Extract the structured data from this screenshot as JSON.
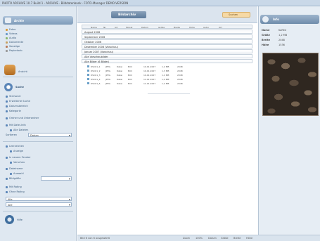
{
  "window": {
    "title": "PHOTO ARCHIVE 10.7 Build 1 - ARCHIVE · Bilddatenbank · FOTO-Manager DEMO-VERSION"
  },
  "sidebar": {
    "panel1_title": "Archiv",
    "items": [
      "Fotos",
      "Videos",
      "Audio",
      "Dokumente",
      "Sonstige",
      "Papierkorb"
    ],
    "panel2_title": "Ansicht",
    "search_section": {
      "title": "Suche",
      "items": [
        "Stichwort",
        "Erweiterte Suche",
        "Datumsbereich",
        "Kategorie",
        "Ordner und Unterordner",
        "Mit Datei-Info",
        "Alle Dateien"
      ],
      "sort_label": "Sortieren",
      "sort_value": "Datum",
      "options": [
        "Leerzeichen",
        "Anzeige",
        "In neuem Fenster",
        "Vorschau",
        "Dateiname",
        "Auswahl",
        "Bildgröße"
      ],
      "filter_items": [
        "Mit Rating",
        "Ohne Rating"
      ],
      "dropdown1": "Alle",
      "dropdown2": "Alle"
    },
    "panel3_title": "Hilfe"
  },
  "center": {
    "title": "Bildarchiv",
    "right_button": "Suchen",
    "columns": [
      "Name",
      "Nr.",
      "Art",
      "Monat",
      "Datum",
      "Größe",
      "Breite",
      "Höhe",
      "Autor",
      "Ort"
    ],
    "groups": [
      "August 2006",
      "September 2006",
      "Oktober 2006",
      "Dezember 2006 (Vorschau)",
      "Januar 2007 (Vorschau)",
      "Alle Vorschaubilder",
      "Alle Bilder (6 Bilder)"
    ],
    "files": [
      [
        "DSC01_1",
        "JPEG",
        "Datei",
        "Bild",
        "10.01.2007",
        "1,2 MB",
        "2048"
      ],
      [
        "DSC01_2",
        "JPEG",
        "Datei",
        "Bild",
        "10.01.2007",
        "1,3 MB",
        "2048"
      ],
      [
        "DSC01_3",
        "JPEG",
        "Datei",
        "Bild",
        "10.01.2007",
        "1,1 MB",
        "2048"
      ],
      [
        "DSC01_4",
        "JPEG",
        "Datei",
        "Bild",
        "11.01.2007",
        "1,4 MB",
        "2048"
      ],
      [
        "DSC01_5",
        "JPEG",
        "Datei",
        "Bild",
        "11.01.2007",
        "1,2 MB",
        "2048"
      ]
    ]
  },
  "right_panel": {
    "title": "Info",
    "props": [
      {
        "k": "Name",
        "v": "Kaffee"
      },
      {
        "k": "Größe",
        "v": "1,2 MB"
      },
      {
        "k": "Breite",
        "v": "2048"
      },
      {
        "k": "Höhe",
        "v": "1536"
      }
    ]
  },
  "status": {
    "left": "Bild 6 von 6 ausgewählt",
    "items": [
      "Zoom",
      "100%",
      "Datum",
      "Größe",
      "Breite",
      "Höhe"
    ]
  }
}
